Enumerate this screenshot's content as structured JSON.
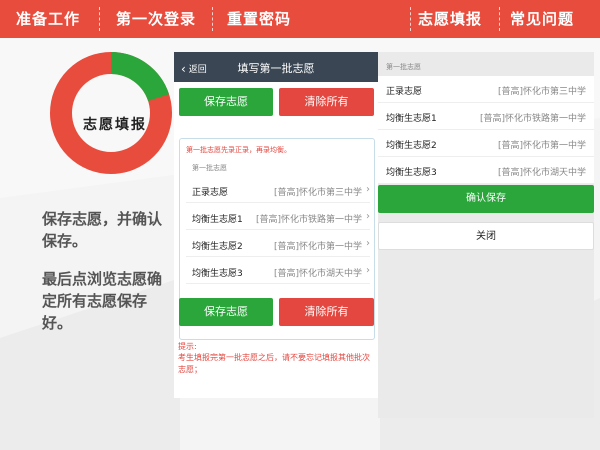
{
  "nav": {
    "items": [
      "准备工作",
      "第一次登录",
      "重置密码",
      "志愿填报",
      "常见问题"
    ]
  },
  "colors": {
    "primary_red": "#e84c3d",
    "green": "#2aa63b",
    "button_red": "#e4473f",
    "header_dark": "#3a4654"
  },
  "donut": {
    "label": "志愿填报",
    "green_fraction": 0.2
  },
  "side_text": {
    "p1": "保存志愿，并确认保存。",
    "p2": "最后点浏览志愿确定所有志愿保存好。"
  },
  "phone": {
    "back_label": "返回",
    "back_icon": "chevron-left-icon",
    "title": "填写第一批志愿",
    "save_label": "保存志愿",
    "clear_label": "清除所有",
    "notice": "第一批志愿先录正录，再录均衡。",
    "section_label": "第一批志愿",
    "rows": [
      {
        "key": "正录志愿",
        "value": "[普高]怀化市第三中学"
      },
      {
        "key": "均衡生志愿1",
        "value": "[普高]怀化市铁路第一中学"
      },
      {
        "key": "均衡生志愿2",
        "value": "[普高]怀化市第一中学"
      },
      {
        "key": "均衡生志愿3",
        "value": "[普高]怀化市湖天中学"
      }
    ],
    "hint_title": "提示:",
    "hint_text": "考生填报完第一批志愿之后，请不要忘记填报其他批次志愿；"
  },
  "confirm": {
    "section_label": "第一批志愿",
    "rows": [
      {
        "key": "正录志愿",
        "value": "[普高]怀化市第三中学"
      },
      {
        "key": "均衡生志愿1",
        "value": "[普高]怀化市铁路第一中学"
      },
      {
        "key": "均衡生志愿2",
        "value": "[普高]怀化市第一中学"
      },
      {
        "key": "均衡生志愿3",
        "value": "[普高]怀化市湖天中学"
      }
    ],
    "confirm_label": "确认保存",
    "close_label": "关闭"
  }
}
